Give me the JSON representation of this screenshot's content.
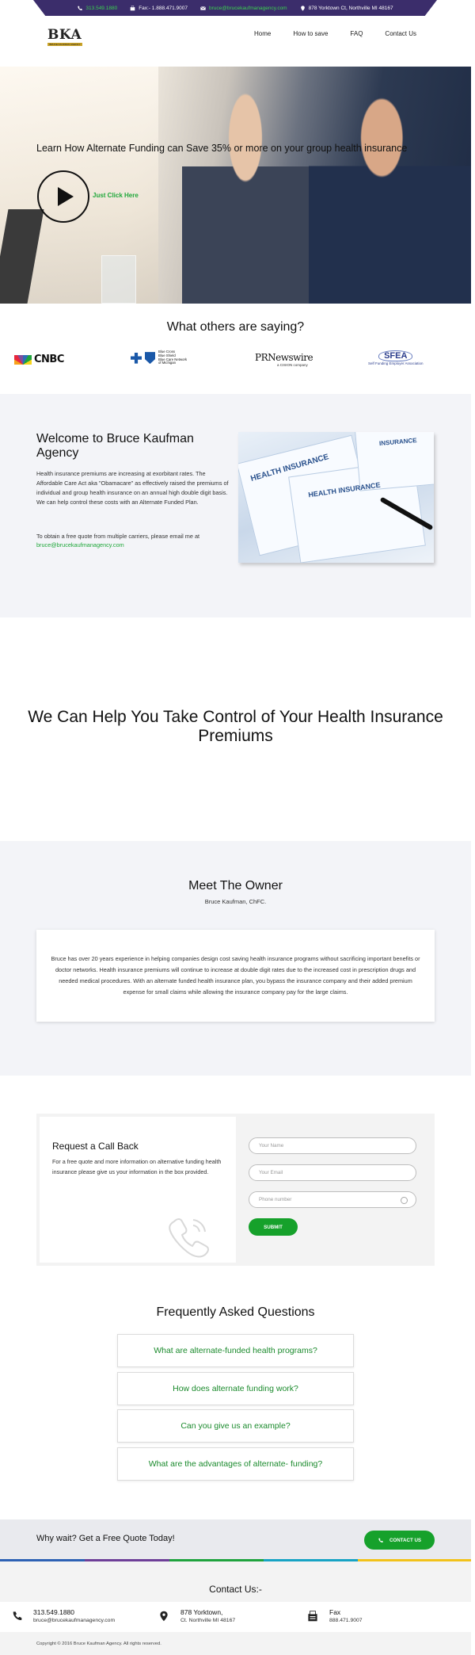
{
  "topbar": {
    "phone": "313.549.1880",
    "fax": "Fax:- 1.888.471.9007",
    "email": "bruce@brucekaufmanagency.com",
    "address": "878 Yorktown Ct, Northville MI 48167"
  },
  "logo": {
    "text": "BKA",
    "tagline": "BRUCE KAUFMAN AGENCY"
  },
  "nav": {
    "items": [
      "Home",
      "How to save",
      "FAQ",
      "Contact Us"
    ]
  },
  "hero": {
    "headline": "Learn How Alternate Funding can Save 35% or more on your group health insurance",
    "cta": "Just Click Here"
  },
  "press": {
    "title": "What others are saying?",
    "cnbc": "CNBC",
    "bcbs": [
      "Blue Cross",
      "Blue Shield",
      "Blue Care Network",
      "of Michigan"
    ],
    "prn_main": "PRNewswire",
    "prn_sub": "a CISION company",
    "sfea_main": "SFEA",
    "sfea_sub": "Self Funding Employer Association"
  },
  "welcome": {
    "title": "Welcome to Bruce Kaufman Agency",
    "para1": "Health insurance premiums are increasing at exorbitant rates. The Affordable Care Act aka \"Obamacare\" as effectively raised the premiums of individual and group health insurance on an annual high double digit basis. We can help control these costs with an Alternate Funded Plan.",
    "para2": "To obtain a free quote from multiple carriers, please email me at",
    "email": "bruce@brucekaufmanagency.com",
    "image_text": [
      "HEALTH INSURANCE",
      "HEALTH INSURANCE",
      "INSURANCE"
    ]
  },
  "headline2": "We Can Help You Take Control of Your Health Insurance Premiums",
  "owner": {
    "title": "Meet The Owner",
    "subtitle": "Bruce Kaufman, ChFC.",
    "bio": "Bruce has over 20 years experience in helping companies design cost saving health insurance programs without sacrificing important benefits or doctor networks. Health insurance premiums will continue to increase at double digit rates due to the increased cost in prescription drugs and needed medical procedures. With an alternate funded health insurance plan, you bypass the insurance company and their added premium expense for small claims while allowing the insurance company pay for the large claims."
  },
  "callback": {
    "title": "Request a Call Back",
    "text": "For a free quote and more information on alternative funding health insurance please give us your information in the box provided.",
    "name_placeholder": "Your Name",
    "email_placeholder": "Your Email",
    "phone_placeholder": "Phone number",
    "submit": "SUBMIT"
  },
  "faq": {
    "title": "Frequently Asked Questions",
    "items": [
      "What are alternate-funded health programs?",
      "How does alternate funding work?",
      "Can you give us an example?",
      "What are the advantages of alternate- funding?"
    ]
  },
  "cta": {
    "text": "Why wait? Get a Free Quote Today!",
    "button": "CONTACT US"
  },
  "contact": {
    "title": "Contact Us:-",
    "phone": "313.549.1880",
    "email": "bruce@brucekaufmanagency.com",
    "address1": "878 Yorktown,",
    "address2": "Ct. Northville MI 48167",
    "fax_label": "Fax",
    "fax": "888.471.9007",
    "copyright": "Copyright © 2016 Bruce Kaufman Agency. All rights reserved."
  },
  "colors": {
    "accent_green": "#16a12b",
    "topbar_purple": "#3b2d6b",
    "section_gray": "#f3f4f8"
  }
}
